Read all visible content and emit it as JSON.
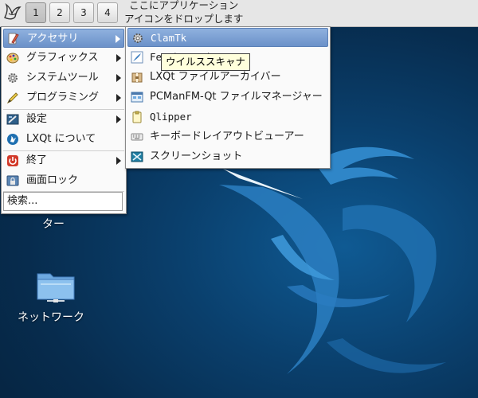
{
  "panel": {
    "desktops": [
      "1",
      "2",
      "3",
      "4"
    ],
    "active_desktop": "1",
    "quicklaunch_hint_line1": "ここにアプリケーション",
    "quicklaunch_hint_line2": "アイコンをドロップします"
  },
  "desktop": {
    "partial_label": "ター",
    "network_label": "ネットワーク"
  },
  "main_menu": {
    "items": [
      {
        "label": "アクセサリ",
        "icon": "accessories-icon",
        "submenu": true,
        "selected": true
      },
      {
        "label": "グラフィックス",
        "icon": "graphics-icon",
        "submenu": true
      },
      {
        "label": "システムツール",
        "icon": "system-tools-icon",
        "submenu": true
      },
      {
        "label": "プログラミング",
        "icon": "programming-icon",
        "submenu": true
      },
      {
        "label": "設定",
        "icon": "settings-icon",
        "submenu": true
      },
      {
        "label": "LXQt について",
        "icon": "lxqt-about-icon",
        "submenu": false
      },
      {
        "label": "終了",
        "icon": "power-icon",
        "submenu": true
      },
      {
        "label": "画面ロック",
        "icon": "lock-screen-icon",
        "submenu": false
      }
    ],
    "search_label": "検索..."
  },
  "sub_menu": {
    "items": [
      {
        "label": "ClamTk",
        "icon": "clamtk-icon",
        "selected": true
      },
      {
        "label": "Featherpad",
        "icon": "featherpad-icon"
      },
      {
        "label": "LXQt ファイルアーカイバー",
        "icon": "archiver-icon"
      },
      {
        "label": "PCManFM-Qt ファイルマネージャー",
        "icon": "file-manager-icon"
      },
      {
        "label": "Qlipper",
        "icon": "clipboard-icon"
      },
      {
        "label": "キーボードレイアウトビューアー",
        "icon": "keyboard-icon"
      },
      {
        "label": "スクリーンショット",
        "icon": "screenshot-icon"
      }
    ]
  },
  "tooltip": {
    "text": "ウイルススキャナ"
  },
  "colors": {
    "selection": "#6b91c9",
    "panel": "#e6e6e6",
    "desktop": "#0a3f6c"
  }
}
